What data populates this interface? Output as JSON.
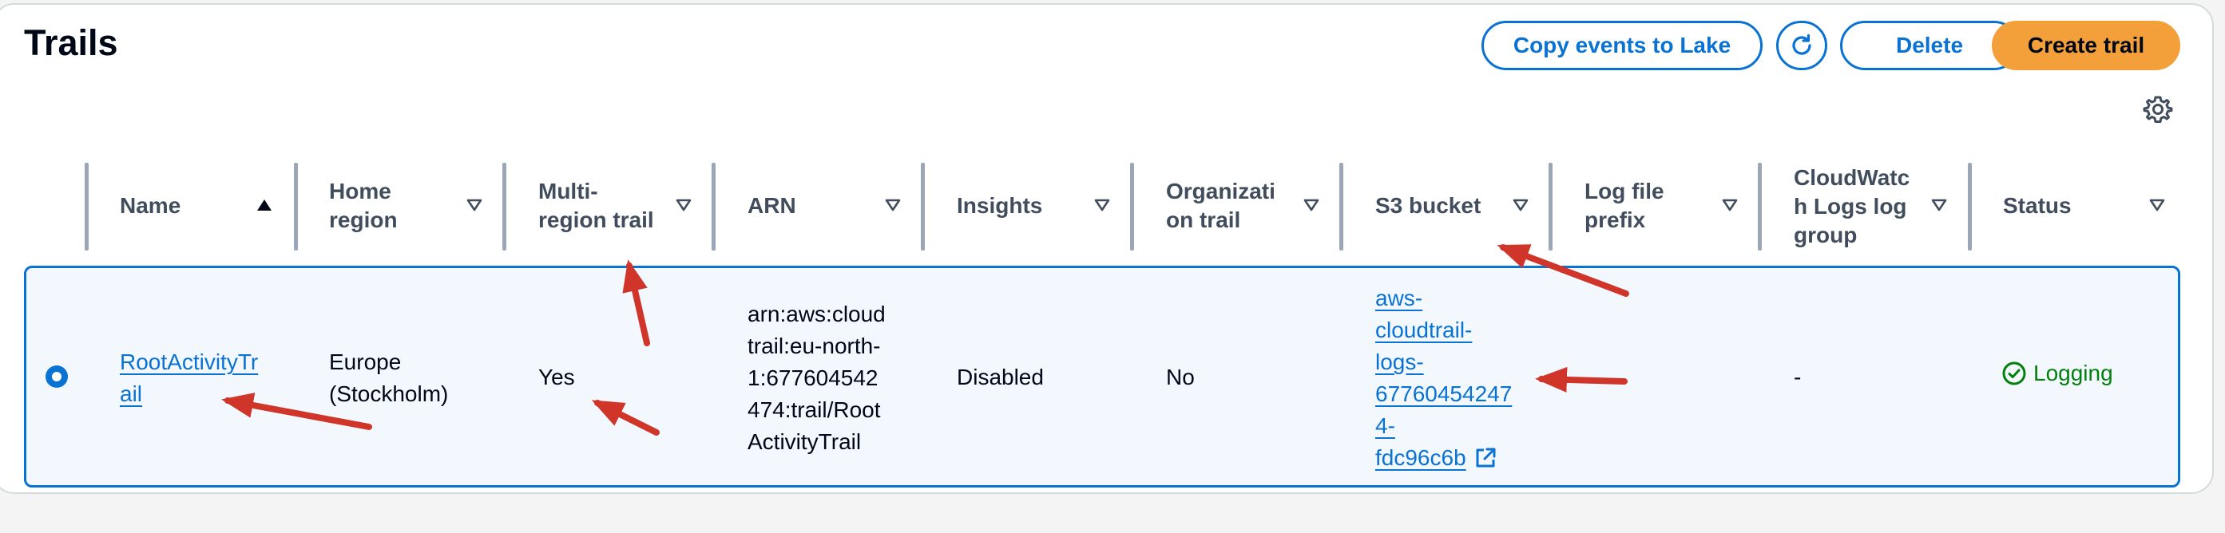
{
  "header": {
    "title": "Trails",
    "copy_events_label": "Copy events to Lake",
    "delete_label": "Delete",
    "create_trail_label": "Create trail"
  },
  "table": {
    "columns": [
      {
        "line1": "Name",
        "line2": "",
        "line3": "",
        "sort": "ascending"
      },
      {
        "line1": "Home",
        "line2": "region",
        "line3": "",
        "sort": "none"
      },
      {
        "line1": "Multi-",
        "line2": "region trail",
        "line3": "",
        "sort": "none"
      },
      {
        "line1": "ARN",
        "line2": "",
        "line3": "",
        "sort": "none"
      },
      {
        "line1": "Insights",
        "line2": "",
        "line3": "",
        "sort": "none"
      },
      {
        "line1": "Organizati",
        "line2": "on trail",
        "line3": "",
        "sort": "none"
      },
      {
        "line1": "S3 bucket",
        "line2": "",
        "line3": "",
        "sort": "none"
      },
      {
        "line1": "Log file",
        "line2": "prefix",
        "line3": "",
        "sort": "none"
      },
      {
        "line1": "CloudWatc",
        "line2": "h Logs log",
        "line3": "group",
        "sort": "none"
      },
      {
        "line1": "Status",
        "line2": "",
        "line3": "",
        "sort": "none"
      }
    ],
    "row": {
      "selected": true,
      "name": [
        "RootActivityTr",
        "ail"
      ],
      "home_region": [
        "Europe",
        "(Stockholm)"
      ],
      "multi_region": "Yes",
      "arn": [
        "arn:aws:cloud",
        "trail:eu-north-",
        "1:677604542",
        "474:trail/Root",
        "ActivityTrail"
      ],
      "insights": "Disabled",
      "organization_trail": "No",
      "s3_bucket": [
        "aws-",
        "cloudtrail-",
        "logs-",
        "67760454247",
        "4-",
        "fdc96c6b"
      ],
      "log_file_prefix": "-",
      "cloudwatch_logs_group": "",
      "status": "Logging"
    }
  },
  "colors": {
    "link": "#0972d3",
    "primary_button": "#f4a03a",
    "row_selected_bg": "#f2f8fd",
    "status_ok": "#037f0c",
    "annotation_arrow": "#d0352a"
  },
  "icons": {
    "refresh": "refresh-icon",
    "settings": "gear-icon",
    "external_link": "external-link-icon",
    "status": "success-check-icon"
  }
}
